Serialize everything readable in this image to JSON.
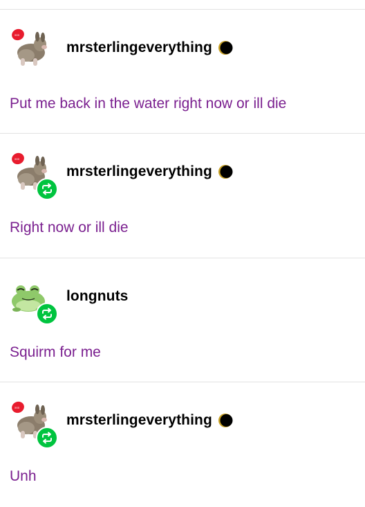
{
  "posts": [
    {
      "username": "mrsterlingeverything",
      "badge_icon": "moon-icon",
      "reblogged": false,
      "avatar": "plush-dog-avatar",
      "text": "Put me back in the water right now or ill die"
    },
    {
      "username": "mrsterlingeverything",
      "badge_icon": "moon-icon",
      "reblogged": true,
      "avatar": "plush-dog-avatar",
      "text": "Right now or ill die"
    },
    {
      "username": "longnuts",
      "badge_icon": "",
      "reblogged": true,
      "avatar": "frog-avatar",
      "text": "Squirm for me"
    },
    {
      "username": "mrsterlingeverything",
      "badge_icon": "moon-icon",
      "reblogged": true,
      "avatar": "plush-dog-avatar",
      "text": "Unh"
    }
  ],
  "colors": {
    "username": "#000000",
    "post_text": "#7a1f8f",
    "reblog_badge": "#00c43f",
    "divider": "#e2e2e2"
  }
}
